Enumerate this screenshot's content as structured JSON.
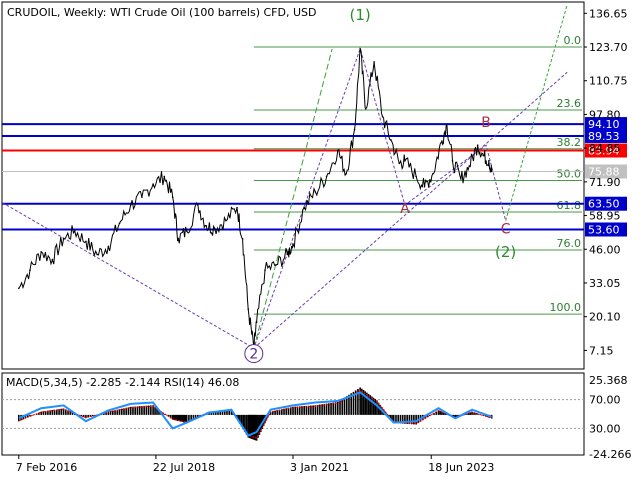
{
  "header": {
    "symbol": "CRUDOIL",
    "timeframe": "Weekly:",
    "description": "WTI Crude Oil (100 barrels) CFD, USD"
  },
  "chart_data": [
    {
      "type": "line",
      "price_axis": [
        "136.65",
        "123.70",
        "110.75",
        "97.80",
        "84.85",
        "71.90",
        "58.95",
        "46.00",
        "33.05",
        "20.10",
        "7.15"
      ],
      "time_axis": [
        "7 Feb 2016",
        "22 Jul 2018",
        "3 Jan 2021",
        "18 Jun 2023"
      ],
      "ylim": [
        0,
        141
      ],
      "grid": false,
      "series": [
        {
          "values": [
            [
              2016.1,
              31
            ],
            [
              2016.3,
              38
            ],
            [
              2016.5,
              45
            ],
            [
              2016.7,
              42
            ],
            [
              2016.9,
              50
            ],
            [
              2017.1,
              53
            ],
            [
              2017.3,
              49
            ],
            [
              2017.5,
              44
            ],
            [
              2017.7,
              47
            ],
            [
              2017.9,
              56
            ],
            [
              2018.1,
              63
            ],
            [
              2018.3,
              66
            ],
            [
              2018.5,
              71
            ],
            [
              2018.7,
              74
            ],
            [
              2018.85,
              66
            ],
            [
              2018.95,
              50
            ],
            [
              2019.1,
              53
            ],
            [
              2019.3,
              63
            ],
            [
              2019.45,
              55
            ],
            [
              2019.6,
              54
            ],
            [
              2019.8,
              57
            ],
            [
              2020.0,
              62
            ],
            [
              2020.1,
              50
            ],
            [
              2020.2,
              23
            ],
            [
              2020.3,
              8
            ],
            [
              2020.35,
              18
            ],
            [
              2020.5,
              38
            ],
            [
              2020.7,
              40
            ],
            [
              2020.9,
              44
            ],
            [
              2021.0,
              48
            ],
            [
              2021.2,
              62
            ],
            [
              2021.4,
              68
            ],
            [
              2021.6,
              74
            ],
            [
              2021.8,
              84
            ],
            [
              2021.95,
              75
            ],
            [
              2022.1,
              92
            ],
            [
              2022.2,
              123
            ],
            [
              2022.3,
              100
            ],
            [
              2022.45,
              118
            ],
            [
              2022.6,
              97
            ],
            [
              2022.75,
              88
            ],
            [
              2022.9,
              79
            ],
            [
              2023.0,
              80
            ],
            [
              2023.2,
              74
            ],
            [
              2023.35,
              70
            ],
            [
              2023.5,
              75
            ],
            [
              2023.65,
              87
            ],
            [
              2023.75,
              94
            ],
            [
              2023.85,
              80
            ],
            [
              2024.0,
              73
            ],
            [
              2024.15,
              78
            ],
            [
              2024.3,
              86
            ],
            [
              2024.4,
              82
            ],
            [
              2024.5,
              80
            ],
            [
              2024.55,
              75.88
            ]
          ]
        }
      ],
      "horizontal_levels": [
        {
          "label": "94.10",
          "value": 94.1,
          "color": "#0000cc"
        },
        {
          "label": "89.53",
          "value": 89.53,
          "color": "#0000cc"
        },
        {
          "label": "83.94",
          "value": 83.94,
          "color": "#ff0000"
        },
        {
          "label": "75.88",
          "value": 75.88,
          "color": "#c0c0c0"
        },
        {
          "label": "63.50",
          "value": 63.5,
          "color": "#0000cc"
        },
        {
          "label": "53.60",
          "value": 53.6,
          "color": "#0000cc"
        }
      ],
      "fibonacci_levels": [
        {
          "label": "0.0",
          "value": 123.7
        },
        {
          "label": "23.6",
          "value": 99.5
        },
        {
          "label": "38.2",
          "value": 84.6
        },
        {
          "label": "50.0",
          "value": 72.4
        },
        {
          "label": "61.8",
          "value": 60.3
        },
        {
          "label": "76.0",
          "value": 45.7
        },
        {
          "label": "100.0",
          "value": 21.1
        }
      ],
      "wave_labels": [
        {
          "label": "(1)",
          "x": 2022.2,
          "value": 134,
          "color": "#2e8b2e"
        },
        {
          "label": "2",
          "x": 2020.3,
          "value": 4,
          "color": "#5b2c8f"
        },
        {
          "label": "A",
          "x": 2023.0,
          "value": 60,
          "color": "#a0304a"
        },
        {
          "label": "B",
          "x": 2024.45,
          "value": 93,
          "color": "#a0304a"
        },
        {
          "label": "C",
          "x": 2024.8,
          "value": 52,
          "color": "#a0304a"
        },
        {
          "label": "(2)",
          "x": 2024.8,
          "value": 43,
          "color": "#2e8b2e"
        }
      ]
    },
    {
      "type": "bar",
      "indicator": "MACD(5,34,5) -2.285 -2.144 RSI(14) 46.08",
      "y_axis": [
        "25.368",
        "70.00",
        "30.00",
        "-24.266"
      ],
      "ylim": [
        -24.266,
        25.368
      ],
      "rsi_levels": [
        70,
        30
      ],
      "macd_histogram": [
        [
          2016.1,
          -4
        ],
        [
          2016.5,
          2
        ],
        [
          2016.9,
          4
        ],
        [
          2017.3,
          -2
        ],
        [
          2017.7,
          2
        ],
        [
          2018.1,
          5
        ],
        [
          2018.5,
          6
        ],
        [
          2018.85,
          -3
        ],
        [
          2019.1,
          -5
        ],
        [
          2019.5,
          2
        ],
        [
          2019.9,
          3
        ],
        [
          2020.2,
          -14
        ],
        [
          2020.35,
          -16
        ],
        [
          2020.6,
          2
        ],
        [
          2021.0,
          5
        ],
        [
          2021.4,
          6
        ],
        [
          2021.8,
          8
        ],
        [
          2022.2,
          17
        ],
        [
          2022.5,
          9
        ],
        [
          2022.8,
          -5
        ],
        [
          2023.2,
          -6
        ],
        [
          2023.6,
          3
        ],
        [
          2023.9,
          -2
        ],
        [
          2024.2,
          2
        ],
        [
          2024.55,
          -2.285
        ]
      ],
      "rsi_values": [
        [
          2016.1,
          44
        ],
        [
          2016.5,
          58
        ],
        [
          2016.9,
          62
        ],
        [
          2017.3,
          40
        ],
        [
          2017.7,
          55
        ],
        [
          2018.1,
          64
        ],
        [
          2018.5,
          66
        ],
        [
          2018.85,
          30
        ],
        [
          2019.1,
          38
        ],
        [
          2019.5,
          52
        ],
        [
          2019.9,
          56
        ],
        [
          2020.2,
          20
        ],
        [
          2020.35,
          25
        ],
        [
          2020.6,
          56
        ],
        [
          2021.0,
          62
        ],
        [
          2021.4,
          66
        ],
        [
          2021.8,
          68
        ],
        [
          2022.2,
          80
        ],
        [
          2022.5,
          62
        ],
        [
          2022.8,
          38
        ],
        [
          2023.2,
          40
        ],
        [
          2023.6,
          58
        ],
        [
          2023.9,
          44
        ],
        [
          2024.2,
          56
        ],
        [
          2024.55,
          46.08
        ]
      ]
    }
  ]
}
